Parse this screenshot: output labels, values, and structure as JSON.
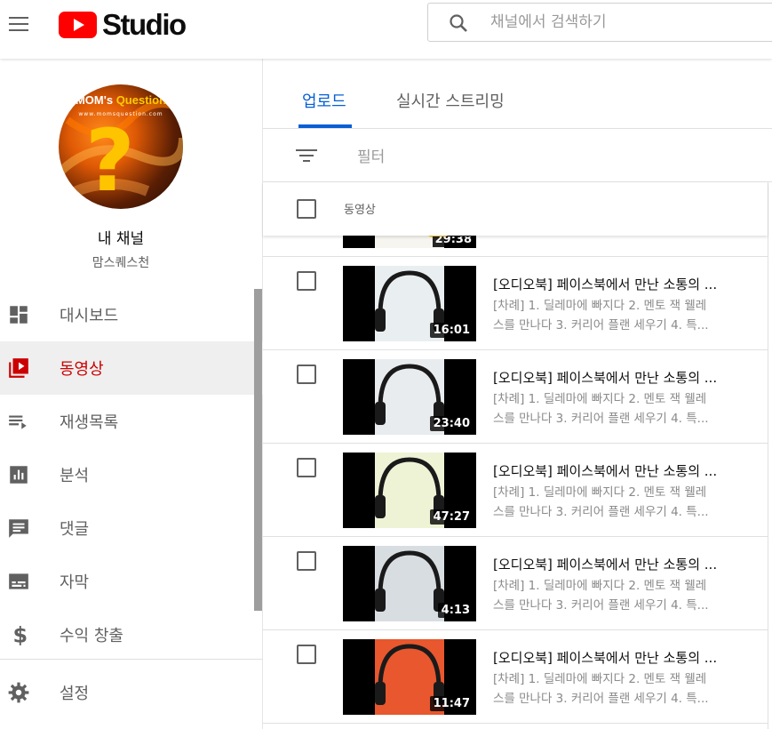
{
  "header": {
    "logo_text": "Studio",
    "search": {
      "placeholder": "채널에서 검색하기"
    }
  },
  "channel": {
    "avatar_title_left": "MOM's",
    "avatar_title_right": "Question",
    "avatar_url": "www.momsquestion.com",
    "name": "내 채널",
    "handle": "맘스퀘스천"
  },
  "sidebar": {
    "items": [
      {
        "label": "대시보드",
        "icon": "dashboard-icon"
      },
      {
        "label": "동영상",
        "icon": "video-library-icon"
      },
      {
        "label": "재생목록",
        "icon": "playlist-icon"
      },
      {
        "label": "분석",
        "icon": "analytics-icon"
      },
      {
        "label": "댓글",
        "icon": "comment-icon"
      },
      {
        "label": "자막",
        "icon": "subtitles-icon"
      },
      {
        "label": "수익 창출",
        "icon": "dollar-icon"
      }
    ],
    "settings_label": "설정",
    "active_index": 1
  },
  "tabs": [
    {
      "label": "업로드",
      "active": true
    },
    {
      "label": "실시간 스트리밍",
      "active": false
    }
  ],
  "filter": {
    "label": "필터"
  },
  "list": {
    "column_label": "동영상",
    "partial_row_duration": "29:38",
    "videos": [
      {
        "title": "[오디오북] 페이스북에서 만난 소통의 ...",
        "desc_line1": "[차례] 1. 딜레마에 빠지다 2. 멘토 잭 웰레",
        "desc_line2": "스를 만나다 3. 커리어 플랜 세우기 4. 특...",
        "duration": "16:01",
        "cover_color": "#e9eef0"
      },
      {
        "title": "[오디오북] 페이스북에서 만난 소통의 ...",
        "desc_line1": "[차례] 1. 딜레마에 빠지다 2. 멘토 잭 웰레",
        "desc_line2": "스를 만나다 3. 커리어 플랜 세우기 4. 특...",
        "duration": "23:40",
        "cover_color": "#e8ecef"
      },
      {
        "title": "[오디오북] 페이스북에서 만난 소통의 ...",
        "desc_line1": "[차례] 1. 딜레마에 빠지다 2. 멘토 잭 웰레",
        "desc_line2": "스를 만나다 3. 커리어 플랜 세우기 4. 특...",
        "duration": "47:27",
        "cover_color": "#eef3d6"
      },
      {
        "title": "[오디오북] 페이스북에서 만난 소통의 ...",
        "desc_line1": "[차례] 1. 딜레마에 빠지다 2. 멘토 잭 웰레",
        "desc_line2": "스를 만나다 3. 커리어 플랜 세우기 4. 특...",
        "duration": "4:13",
        "cover_color": "#d8dde2"
      },
      {
        "title": "[오디오북] 페이스북에서 만난 소통의 ...",
        "desc_line1": "[차례] 1. 딜레마에 빠지다 2. 멘토 잭 웰레",
        "desc_line2": "스를 만나다 3. 커리어 플랜 세우기 4. 특...",
        "duration": "11:47",
        "cover_color": "#e8572d"
      }
    ]
  },
  "colors": {
    "accent_blue": "#065fd4",
    "active_red": "#cc0000",
    "youtube_red": "#ff0000"
  }
}
